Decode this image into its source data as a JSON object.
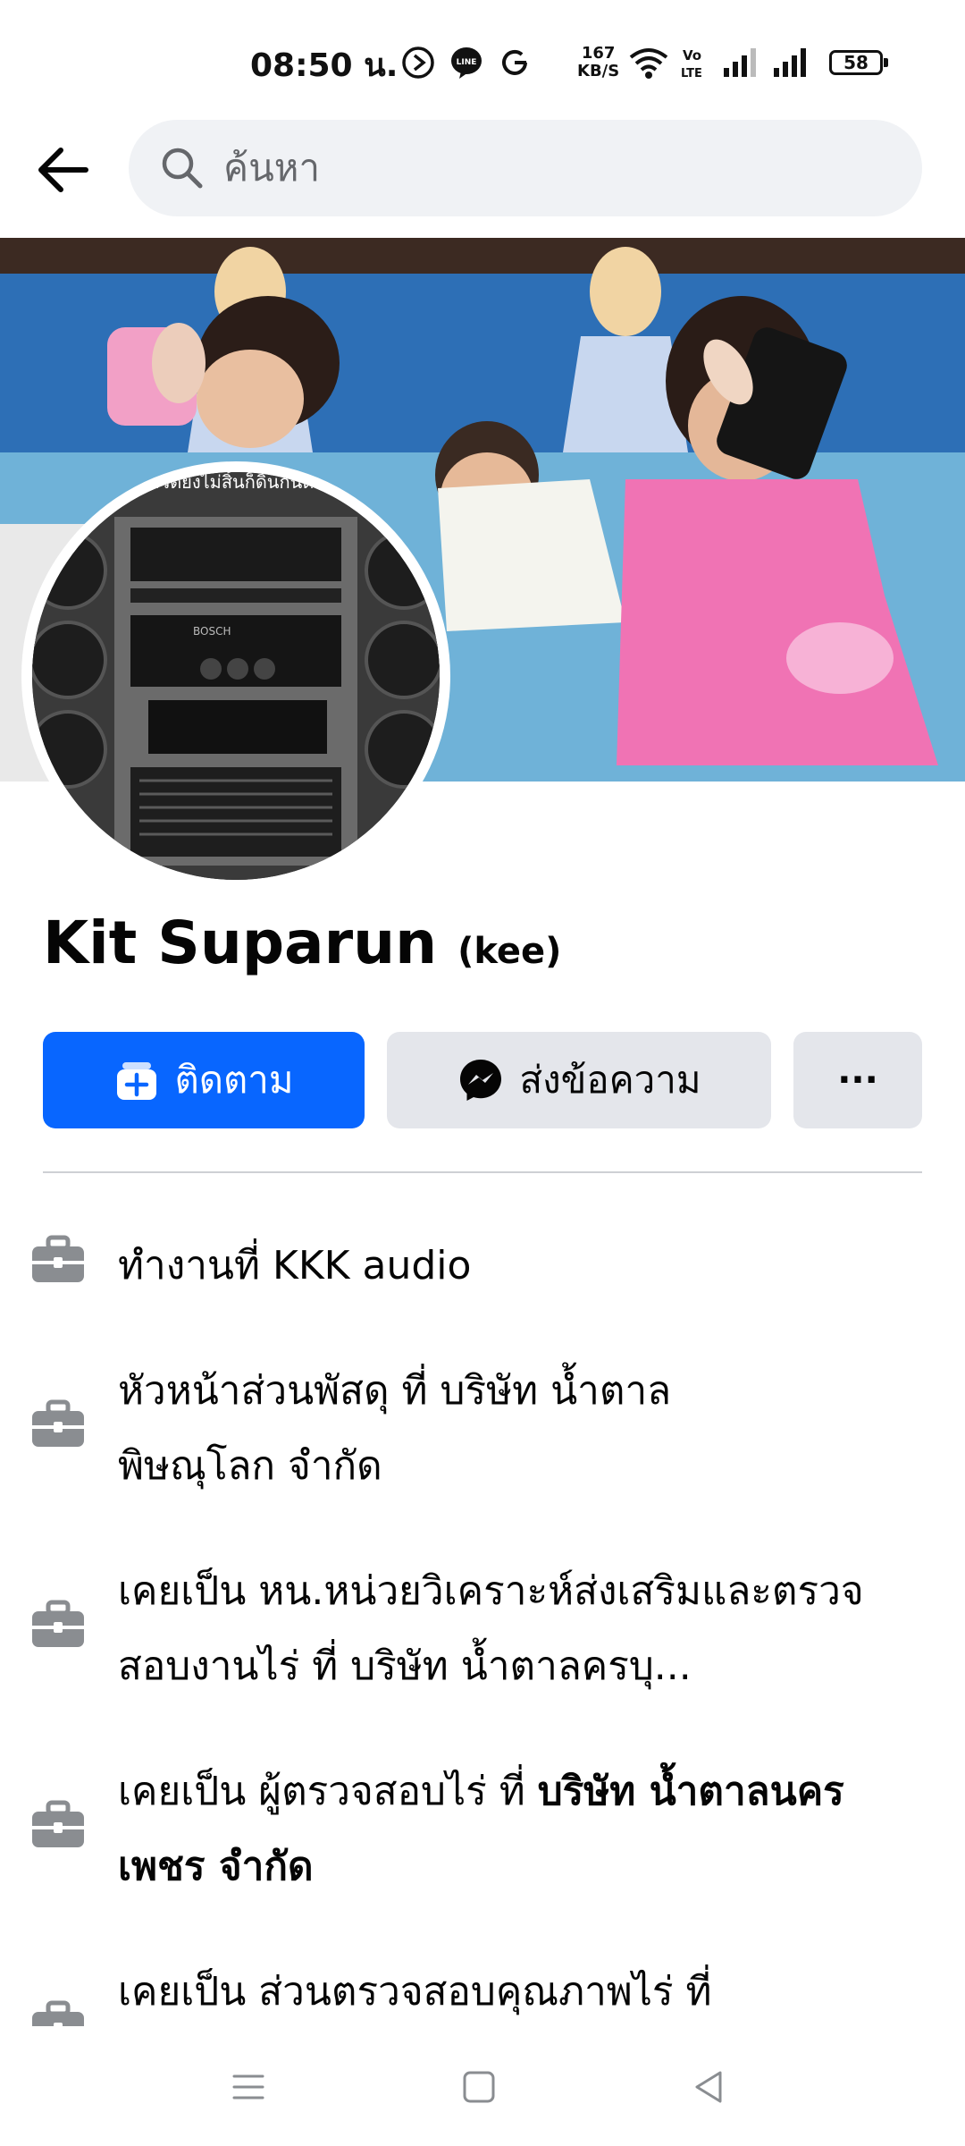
{
  "status_bar": {
    "time": "08:50 น.",
    "net_speed_value": "167",
    "net_speed_unit": "KB/S",
    "battery": "58"
  },
  "search": {
    "placeholder": "ค้นหา"
  },
  "profile": {
    "name": "Kit Suparun",
    "alternate_name": "(kee)",
    "avatar_caption": "ถ้าชีวิตยังไม่สิ้นก็ดิ้นกันต่อไป",
    "avatar_brand": "BOSCH"
  },
  "actions": {
    "follow_label": "ติดตาม",
    "message_label": "ส่งข้อความ",
    "more_label": "···"
  },
  "work": [
    {
      "text": "ทำงานที่ KKK audio"
    },
    {
      "text": "หัวหน้าส่วนพัสดุ ที่ บริษัท น้ำตาล พิษณุโลก จำกัด"
    },
    {
      "text": "เคยเป็น หน.หน่วยวิเคราะห์ส่งเสริมและตรวจสอบงานไร่ ที่ บริษัท น้ำตาลครบุ..."
    },
    {
      "text_prefix": "เคยเป็น ผู้ตรวจสอบไร่ ที่ ",
      "text_bold": "บริษัท น้ำตาลนครเพชร จำกัด"
    },
    {
      "text": "เคยเป็น ส่วนตรวจสอบคุณภาพไร่ ที่"
    }
  ],
  "colors": {
    "accent": "#0866ff",
    "secondary_button": "#e4e6eb",
    "icon_gray": "#8a8d91",
    "search_bg": "#f0f2f5"
  }
}
